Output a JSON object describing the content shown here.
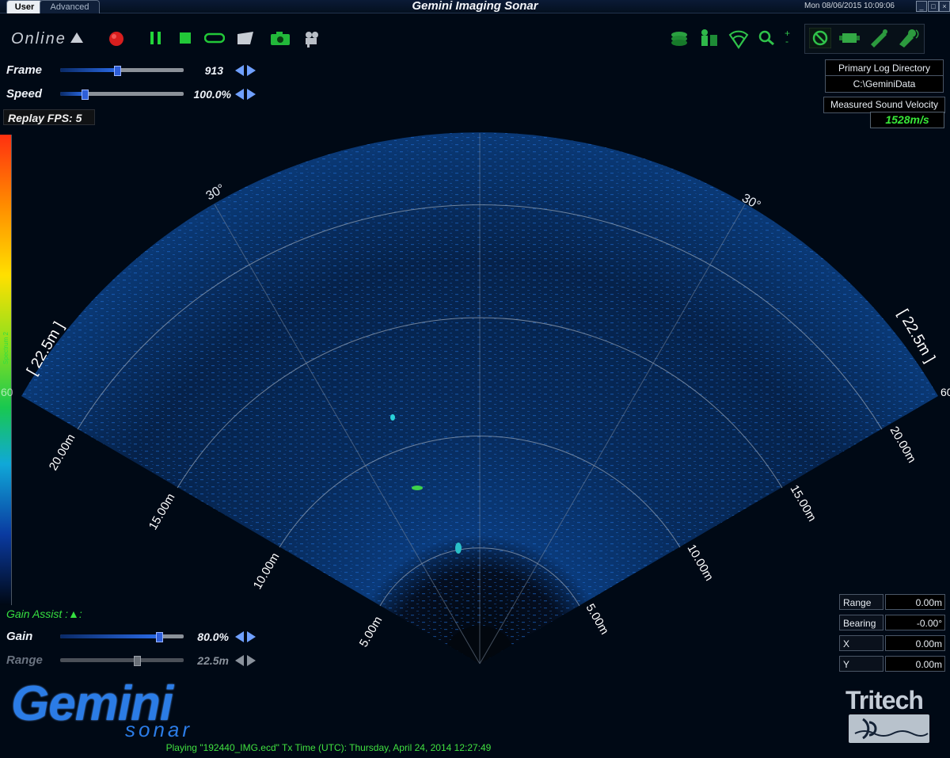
{
  "tabs": {
    "user": "User",
    "advanced": "Advanced"
  },
  "app_title": "Gemini Imaging Sonar",
  "datetime": "Mon 08/06/2015    10:09:06",
  "toolbar": {
    "online_label": "Online"
  },
  "controls": {
    "frame": {
      "label": "Frame",
      "value": "913",
      "fraction": 0.46
    },
    "speed": {
      "label": "Speed",
      "value": "100.0%",
      "fraction": 0.2
    },
    "replay_fps": "Replay FPS:  5"
  },
  "colorbar": {
    "label": "Spectrum 2"
  },
  "log": {
    "header": "Primary Log Directory",
    "path": "C:\\GeminiData"
  },
  "sound_velocity": {
    "header": "Measured Sound Velocity",
    "value": "1528m/s"
  },
  "sonar": {
    "range_brackets": [
      "[ 22.5m ]",
      "[ 22.5m ]"
    ],
    "angle_labels": [
      "30°",
      "30°"
    ],
    "edge_label_right": "60",
    "edge_label_left": "60",
    "range_labels_left": [
      "20.00m",
      "15.00m",
      "10.00m",
      "5.00m"
    ],
    "range_labels_right": [
      "20.00m",
      "15.00m",
      "10.00m",
      "5.00m"
    ]
  },
  "gain_assist": "Gain Assist :▲:",
  "gain": {
    "label": "Gain",
    "value": "80.0%",
    "fraction": 0.8
  },
  "range": {
    "label": "Range",
    "value": "22.5m",
    "fraction": 0.62
  },
  "readout": {
    "range": {
      "label": "Range",
      "value": "0.00m"
    },
    "bearing": {
      "label": "Bearing",
      "value": "-0.00°"
    },
    "x": {
      "label": "X",
      "value": "0.00m"
    },
    "y": {
      "label": "Y",
      "value": "0.00m"
    }
  },
  "logos": {
    "gemini": "Gemini",
    "sonar": "sonar",
    "tritech": "Tritech"
  },
  "status_text": "Playing \"192440_IMG.ecd\" Tx Time (UTC): Thursday, April 24, 2014 12:27:49"
}
